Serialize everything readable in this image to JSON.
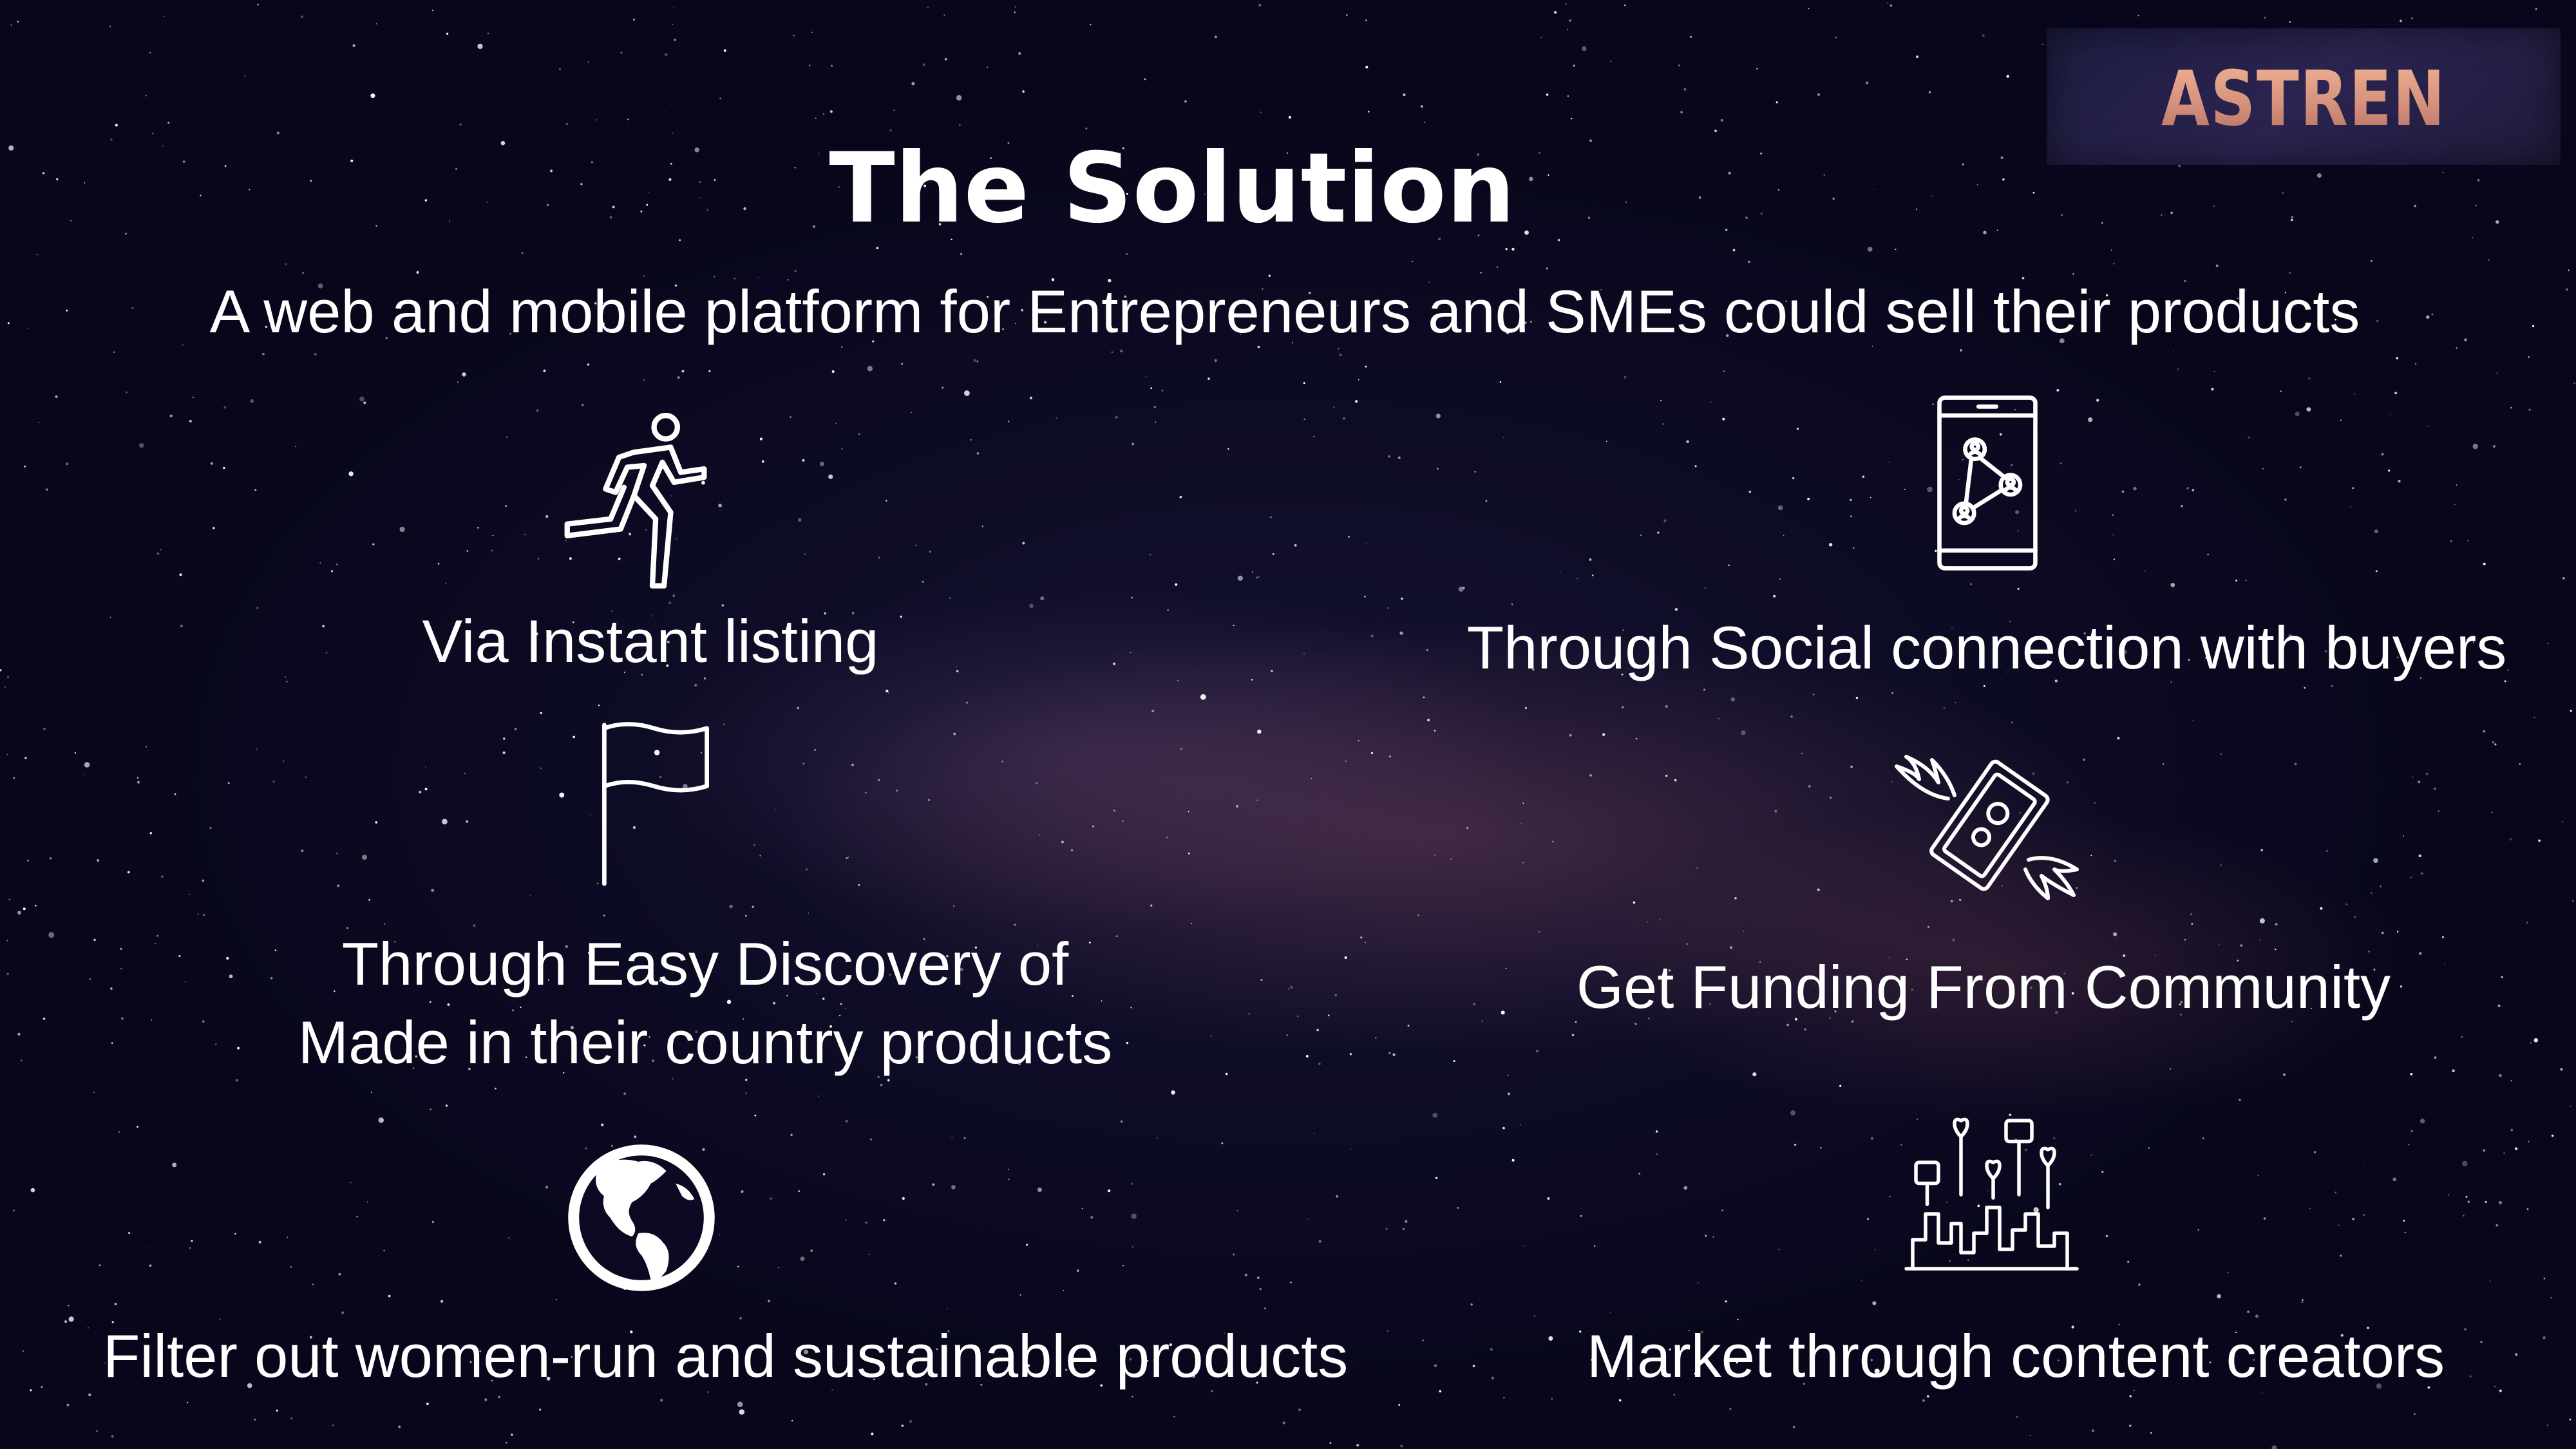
{
  "brand": {
    "logo_text": "ASTREN"
  },
  "slide": {
    "title": "The Solution",
    "subtitle": "A web and mobile platform for Entrepreneurs and SMEs could sell their products"
  },
  "features": [
    {
      "icon": "running-person-icon",
      "label": "Via Instant listing"
    },
    {
      "icon": "smartphone-network-icon",
      "label": "Through Social connection with buyers"
    },
    {
      "icon": "flag-icon",
      "line1": "Through Easy Discovery of",
      "line2": "Made in their country products"
    },
    {
      "icon": "flying-money-icon",
      "label": "Get Funding From Community"
    },
    {
      "icon": "globe-icon",
      "label": "Filter out women-run and sustainable products"
    },
    {
      "icon": "social-city-icon",
      "label": "Market through content creators"
    }
  ],
  "colors": {
    "background": "#07061a",
    "text": "#ffffff",
    "logo": "#e3a48a"
  }
}
